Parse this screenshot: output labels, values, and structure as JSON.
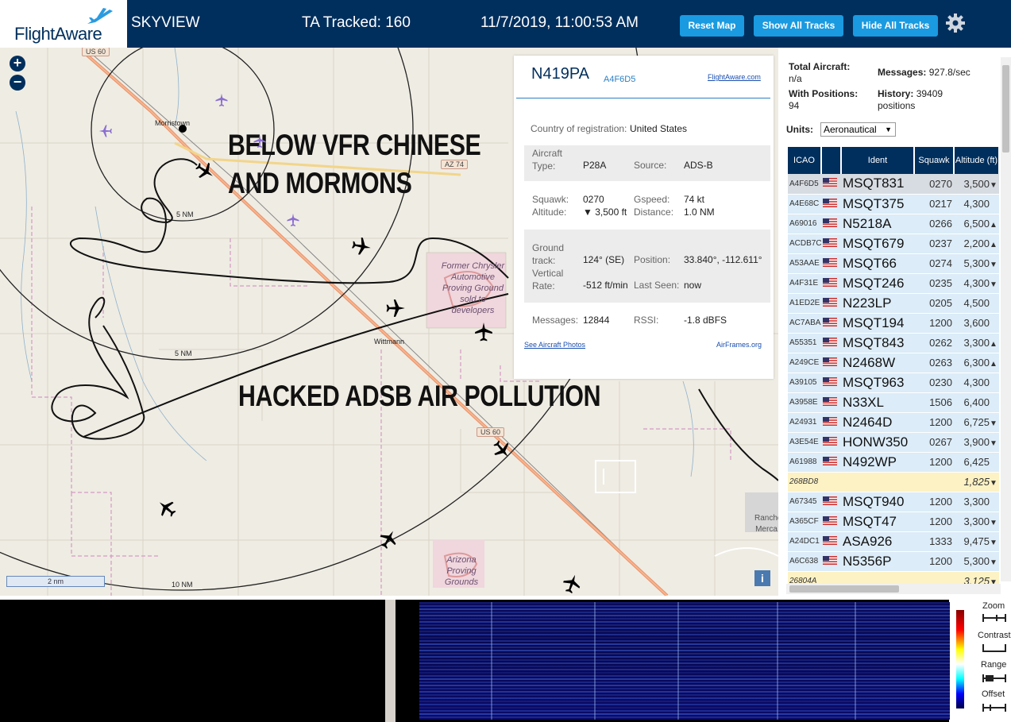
{
  "header": {
    "logo_text": "FlightAware",
    "app_name": "SKYVIEW",
    "tracked": "TA Tracked: 160",
    "datetime": "11/7/2019, 11:00:53 AM",
    "buttons": [
      "Reset Map",
      "Show All Tracks",
      "Hide All Tracks"
    ],
    "settings_icon": "gear-icon"
  },
  "map": {
    "zoom_in": "+",
    "zoom_out": "−",
    "places": [
      "Morristown",
      "Wittmann"
    ],
    "route_shields": [
      "US 60",
      "AZ 74",
      "US 60"
    ],
    "range_rings": [
      "5 NM",
      "5 NM",
      "10 NM"
    ],
    "poi": [
      "Former Chrysler Automotive Proving Ground sold to developers",
      "Arizona Proving Grounds",
      "Rancho Merca"
    ],
    "overlay_text_1": "BELOW VFR CHINESE",
    "overlay_text_2": "AND MORMONS",
    "overlay_text_3": "HACKED ADSB AIR POLLUTION",
    "scale": "2 nm",
    "info_icon": "i"
  },
  "popup": {
    "registration": "N419PA",
    "hex": "A4F6D5",
    "fa_link": "FlightAware.com",
    "country_label": "Country of registration:",
    "country": "United States",
    "aircraft_type_label": "Aircraft Type:",
    "aircraft_type": "P28A",
    "source_label": "Source:",
    "source": "ADS-B",
    "squawk_label": "Squawk:",
    "squawk": "0270",
    "gspeed_label": "Gspeed:",
    "gspeed": "74 kt",
    "altitude_label": "Altitude:",
    "altitude": "▼ 3,500 ft",
    "distance_label": "Distance:",
    "distance": "1.0 NM",
    "ground_track_label": "Ground track:",
    "ground_track": "124° (SE)",
    "position_label": "Position:",
    "position": "33.840°, -112.611°",
    "vertical_rate_label": "Vertical Rate:",
    "vertical_rate": "-512 ft/min",
    "last_seen_label": "Last Seen:",
    "last_seen": "now",
    "messages_label": "Messages:",
    "messages": "12844",
    "rssi_label": "RSSI:",
    "rssi": "-1.8 dBFS",
    "photos_link": "See Aircraft Photos",
    "airframes_link": "AirFrames.org"
  },
  "sidebar": {
    "total_aircraft_label": "Total Aircraft:",
    "total_aircraft": "n/a",
    "messages_label": "Messages:",
    "messages": "927.8/sec",
    "with_positions_label": "With Positions:",
    "with_positions": "94",
    "history_label": "History:",
    "history": "39409 positions",
    "units_label": "Units:",
    "units_value": "Aeronautical",
    "columns": [
      "ICAO",
      "",
      "Ident",
      "Squawk",
      "Altitude (ft)"
    ],
    "rows": [
      {
        "icao": "A4F6D5",
        "flag": true,
        "ident": "MSQT831",
        "squawk": "0270",
        "alt": "3,500",
        "trend": "▼",
        "style": "sel"
      },
      {
        "icao": "A4E68C",
        "flag": true,
        "ident": "MSQT375",
        "squawk": "0217",
        "alt": "4,300",
        "trend": "",
        "style": "r"
      },
      {
        "icao": "A69016",
        "flag": true,
        "ident": "N5218A",
        "squawk": "0266",
        "alt": "6,500",
        "trend": "▲",
        "style": "r"
      },
      {
        "icao": "ACDB7C",
        "flag": true,
        "ident": "MSQT679",
        "squawk": "0237",
        "alt": "2,200",
        "trend": "▲",
        "style": "r"
      },
      {
        "icao": "A53AAE",
        "flag": true,
        "ident": "MSQT66",
        "squawk": "0274",
        "alt": "5,300",
        "trend": "▼",
        "style": "r"
      },
      {
        "icao": "A4F31E",
        "flag": true,
        "ident": "MSQT246",
        "squawk": "0235",
        "alt": "4,300",
        "trend": "▼",
        "style": "r"
      },
      {
        "icao": "A1ED2E",
        "flag": true,
        "ident": "N223LP",
        "squawk": "0205",
        "alt": "4,500",
        "trend": "",
        "style": "r"
      },
      {
        "icao": "AC7ABA",
        "flag": true,
        "ident": "MSQT194",
        "squawk": "1200",
        "alt": "3,600",
        "trend": "",
        "style": "r"
      },
      {
        "icao": "A55351",
        "flag": true,
        "ident": "MSQT843",
        "squawk": "0262",
        "alt": "3,300",
        "trend": "▲",
        "style": "r"
      },
      {
        "icao": "A249CE",
        "flag": true,
        "ident": "N2468W",
        "squawk": "0263",
        "alt": "6,300",
        "trend": "▲",
        "style": "r"
      },
      {
        "icao": "A39105",
        "flag": true,
        "ident": "MSQT963",
        "squawk": "0230",
        "alt": "4,300",
        "trend": "",
        "style": "r"
      },
      {
        "icao": "A3958E",
        "flag": true,
        "ident": "N33XL",
        "squawk": "1506",
        "alt": "6,400",
        "trend": "",
        "style": "r"
      },
      {
        "icao": "A24931",
        "flag": true,
        "ident": "N2464D",
        "squawk": "1200",
        "alt": "6,725",
        "trend": "▼",
        "style": "r"
      },
      {
        "icao": "A3E54E",
        "flag": true,
        "ident": "HONW350",
        "squawk": "0267",
        "alt": "3,900",
        "trend": "▼",
        "style": "r"
      },
      {
        "icao": "A61988",
        "flag": true,
        "ident": "N492WP",
        "squawk": "1200",
        "alt": "6,425",
        "trend": "",
        "style": "r"
      },
      {
        "icao": "268BD8",
        "flag": false,
        "ident": "",
        "squawk": "",
        "alt": "1,825",
        "trend": "▼",
        "style": "y"
      },
      {
        "icao": "A67345",
        "flag": true,
        "ident": "MSQT940",
        "squawk": "1200",
        "alt": "3,300",
        "trend": "",
        "style": "r"
      },
      {
        "icao": "A365CF",
        "flag": true,
        "ident": "MSQT47",
        "squawk": "1200",
        "alt": "3,300",
        "trend": "▼",
        "style": "r"
      },
      {
        "icao": "A24DC1",
        "flag": true,
        "ident": "ASA926",
        "squawk": "1333",
        "alt": "9,475",
        "trend": "▼",
        "style": "r"
      },
      {
        "icao": "A6C638",
        "flag": true,
        "ident": "N5356P",
        "squawk": "1200",
        "alt": "5,300",
        "trend": "▼",
        "style": "r"
      },
      {
        "icao": "26804A",
        "flag": false,
        "ident": "",
        "squawk": "",
        "alt": "3,125",
        "trend": "▼",
        "style": "y"
      }
    ]
  },
  "waterfall": {
    "controls": [
      "Zoom",
      "Contrast",
      "Range",
      "Offset"
    ]
  }
}
